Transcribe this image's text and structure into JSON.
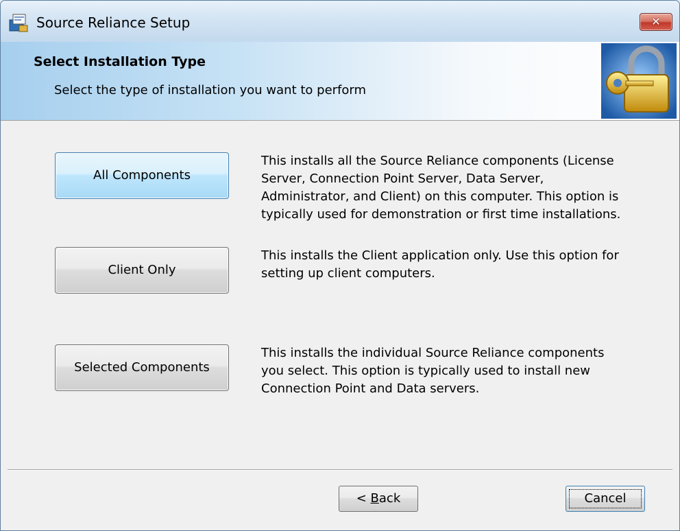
{
  "window": {
    "title": "Source Reliance Setup",
    "close_symbol": "✕"
  },
  "banner": {
    "title": "Select Installation Type",
    "subtitle": "Select the type of installation you want to perform"
  },
  "options": [
    {
      "label": "All Components",
      "description_lines": [
        "This installs all the Source Reliance components (License",
        "Server, Connection Point Server, Data Server,",
        "Administrator, and Client) on this computer. This option is",
        "typically used for demonstration or first time installations."
      ]
    },
    {
      "label": "Client Only",
      "description_lines": [
        "This installs the Client application only. Use this option for",
        "setting up client computers."
      ]
    },
    {
      "label": "Selected Components",
      "description_lines": [
        "This installs the individual Source Reliance components",
        "you select. This option is typically used to install new",
        "Connection Point and Data servers."
      ]
    }
  ],
  "footer": {
    "back_prefix": "< ",
    "back_accel": "B",
    "back_rest": "ack",
    "cancel_label": "Cancel"
  },
  "icons": {
    "app": "setup-box-icon",
    "lock": "padlock-key-icon"
  },
  "colors": {
    "banner_start": "#a6cfee",
    "default_button": "#bee6fd",
    "close_button": "#c0392b"
  }
}
